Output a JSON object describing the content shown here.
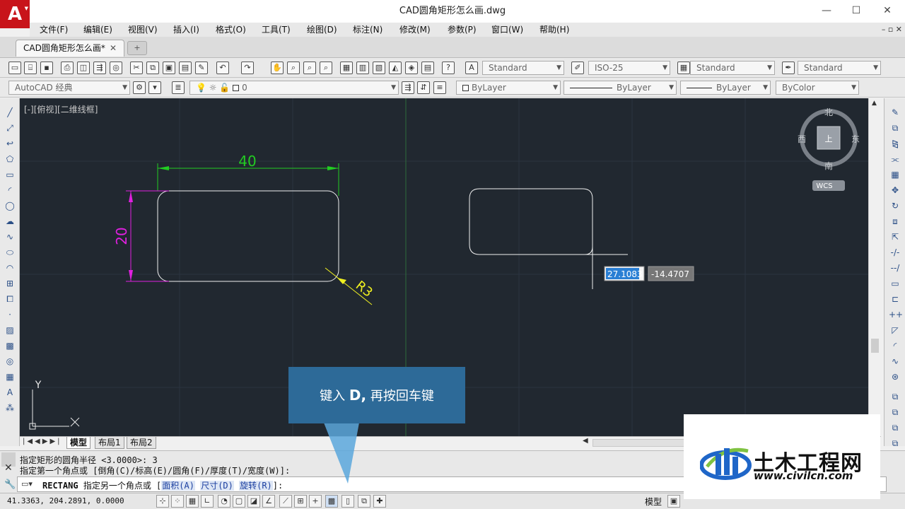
{
  "window": {
    "title": "CAD圆角矩形怎么画.dwg",
    "minimize": "—",
    "maximize": "☐",
    "close": "✕"
  },
  "app_logo": "A",
  "menu": [
    "文件(F)",
    "编辑(E)",
    "视图(V)",
    "插入(I)",
    "格式(O)",
    "工具(T)",
    "绘图(D)",
    "标注(N)",
    "修改(M)",
    "参数(P)",
    "窗口(W)",
    "帮助(H)"
  ],
  "mdi_controls": "– ▫ ✕",
  "tab": {
    "label": "CAD圆角矩形怎么画*",
    "close": "✕"
  },
  "styles": {
    "text_style": "Standard",
    "dim_style": "ISO-25",
    "table_style": "Standard",
    "multileader_style": "Standard"
  },
  "workspace": "AutoCAD 经典",
  "layer": "0",
  "properties": {
    "color": "ByLayer",
    "linetype": "ByLayer",
    "lineweight": "ByLayer",
    "plotstyle": "ByColor"
  },
  "viewport_label": "[-][俯视][二维线框]",
  "viewcube": {
    "north": "北",
    "south": "南",
    "east": "东",
    "west": "西",
    "coord_system": "WCS"
  },
  "drawing": {
    "dim_width": "40",
    "dim_height": "20",
    "dim_radius": "R3",
    "input_x": "27.1083",
    "input_y": "-14.4707"
  },
  "ucs": {
    "y_label": "Y"
  },
  "layout_tabs": [
    "模型",
    "布局1",
    "布局2"
  ],
  "command_history": [
    "指定矩形的圆角半径 <3.0000>: 3",
    "指定第一个角点或 [倒角(C)/标高(E)/圆角(F)/厚度(T)/宽度(W)]:"
  ],
  "command_prompt": {
    "command": "RECTANG",
    "text": "指定另一个角点或 [",
    "options": [
      "面积(A)",
      "尺寸(D)",
      "旋转(R)"
    ],
    "end": "]:"
  },
  "status": {
    "coords": "41.3363,  204.2891, 0.0000",
    "model": "模型"
  },
  "callout": {
    "prefix": "键入",
    "key": "D,",
    "suffix": "再按回车键"
  },
  "watermark": {
    "title": "土木工程网",
    "url": "www.civilcn.com"
  },
  "colors": {
    "canvas_bg": "#212830",
    "dimension_green": "#22cc22",
    "dimension_magenta": "#e020e0",
    "dimension_yellow": "#f0f020",
    "geometry_white": "#f0f0f0",
    "callout_blue": "#2d6a98"
  }
}
